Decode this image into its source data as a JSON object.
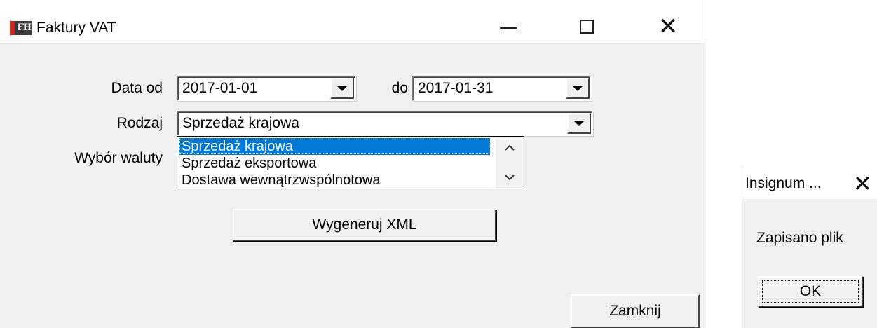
{
  "window": {
    "title": "Faktury VAT",
    "icon_text": "FH",
    "buttons": {
      "minimize": "minimize-icon",
      "maximize": "maximize-icon",
      "close": "close-icon"
    }
  },
  "form": {
    "date_from_label": "Data od",
    "date_from_value": "2017-01-01",
    "date_to_label": "do",
    "date_to_value": "2017-01-31",
    "type_label": "Rodzaj",
    "type_value": "Sprzedaż krajowa",
    "currency_label": "Wybór waluty",
    "dropdown_options": [
      "Sprzedaż krajowa",
      "Sprzedaż eksportowa",
      "Dostawa wewnątrzwspólnotowa"
    ],
    "selected_index": 0,
    "generate_button": "Wygeneruj XML",
    "close_button": "Zamknij"
  },
  "message_box": {
    "title": "Insignum ...",
    "close_glyph": "✕",
    "text": "Zapisano plik",
    "ok_button": "OK"
  },
  "colors": {
    "window_bg": "#f0f0f0",
    "selection": "#0078d7",
    "titlebar_bg": "#ffffff"
  }
}
